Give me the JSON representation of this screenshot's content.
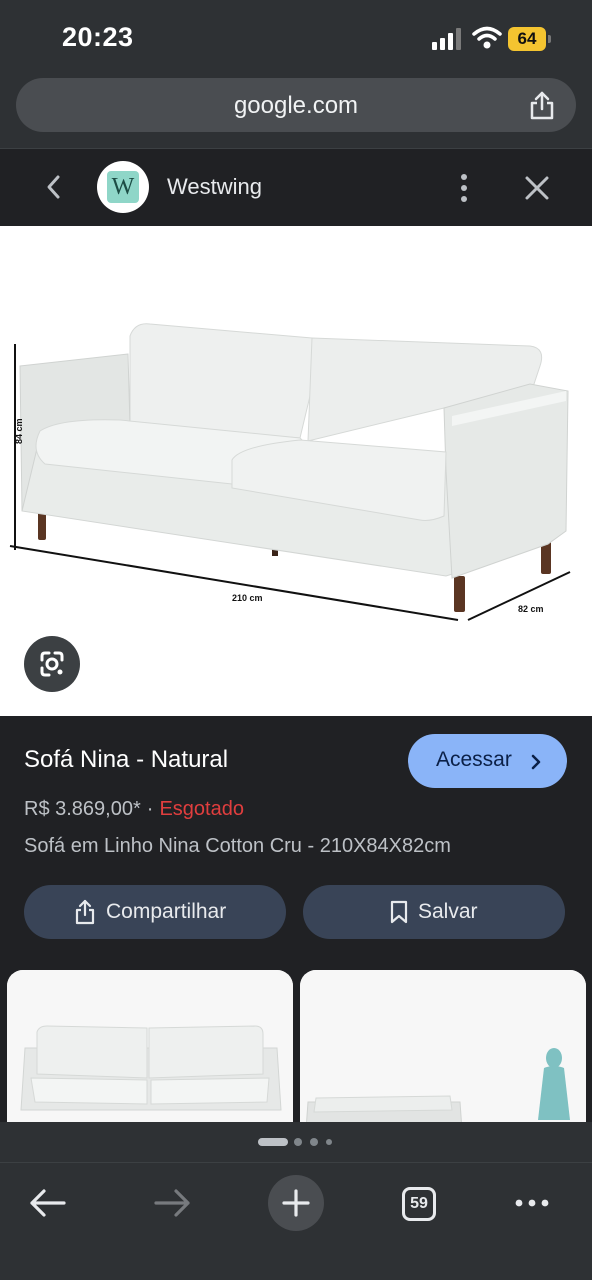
{
  "status_bar": {
    "time": "20:23",
    "battery": "64",
    "battery_color": "#f4c430"
  },
  "url_bar": {
    "url": "google.com"
  },
  "site": {
    "name": "Westwing",
    "logo_letter": "W"
  },
  "image": {
    "dimension_height": "84 cm",
    "dimension_width": "210 cm",
    "dimension_depth": "82 cm"
  },
  "product": {
    "title": "Sofá Nina - Natural",
    "visit_label": "Acessar",
    "price": "R$ 3.869,00*",
    "separator": "·",
    "stock_status": "Esgotado",
    "description": "Sofá em Linho Nina Cotton Cru - 210X84X82cm",
    "share_label": "Compartilhar",
    "save_label": "Salvar"
  },
  "toolbar": {
    "tab_count": "59"
  },
  "colors": {
    "accent": "#8ab4f8",
    "out_of_stock": "#e03e3e",
    "button_bg": "#394457"
  }
}
